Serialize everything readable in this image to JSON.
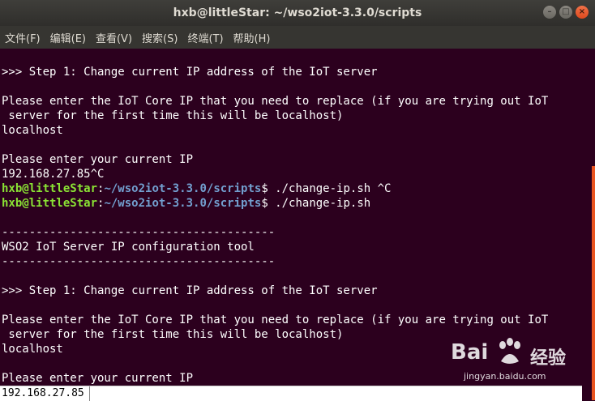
{
  "window": {
    "title": "hxb@littleStar: ~/wso2iot-3.3.0/scripts",
    "buttons": {
      "minimize": "–",
      "maximize": "□",
      "close": "×"
    }
  },
  "menu": [
    "文件(F)",
    "编辑(E)",
    "查看(V)",
    "搜索(S)",
    "终端(T)",
    "帮助(H)"
  ],
  "terminal": {
    "lines": [
      {
        "type": "text",
        "text": ">>> Step 1: Change current IP address of the IoT server"
      },
      {
        "type": "text",
        "text": ""
      },
      {
        "type": "text",
        "text": "Please enter the IoT Core IP that you need to replace (if you are trying out IoT"
      },
      {
        "type": "text",
        "text": " server for the first time this will be localhost)"
      },
      {
        "type": "text",
        "text": "localhost"
      },
      {
        "type": "text",
        "text": ""
      },
      {
        "type": "text",
        "text": "Please enter your current IP"
      },
      {
        "type": "text",
        "text": "192.168.27.85^C"
      },
      {
        "type": "prompt",
        "user": "hxb@littleStar",
        "sep": ":",
        "path": "~/wso2iot-3.3.0/scripts",
        "cmd": "$ ./change-ip.sh ^C"
      },
      {
        "type": "prompt",
        "user": "hxb@littleStar",
        "sep": ":",
        "path": "~/wso2iot-3.3.0/scripts",
        "cmd": "$ ./change-ip.sh"
      },
      {
        "type": "text",
        "text": ""
      },
      {
        "type": "text",
        "text": "----------------------------------------"
      },
      {
        "type": "text",
        "text": "WSO2 IoT Server IP configuration tool"
      },
      {
        "type": "text",
        "text": "----------------------------------------"
      },
      {
        "type": "text",
        "text": ""
      },
      {
        "type": "text",
        "text": ">>> Step 1: Change current IP address of the IoT server"
      },
      {
        "type": "text",
        "text": ""
      },
      {
        "type": "text",
        "text": "Please enter the IoT Core IP that you need to replace (if you are trying out IoT"
      },
      {
        "type": "text",
        "text": " server for the first time this will be localhost)"
      },
      {
        "type": "text",
        "text": "localhost"
      },
      {
        "type": "text",
        "text": ""
      },
      {
        "type": "text",
        "text": "Please enter your current IP"
      }
    ],
    "input_value": "192.168.27.85"
  },
  "watermark": {
    "logo": "Bai",
    "logo_suffix": "",
    "cn": "经验",
    "url": "jingyan.baidu.com"
  },
  "colors": {
    "background": "#2c001e",
    "prompt_user": "#8ae234",
    "prompt_path": "#729fcf",
    "scroll_thumb": "#e95420"
  }
}
